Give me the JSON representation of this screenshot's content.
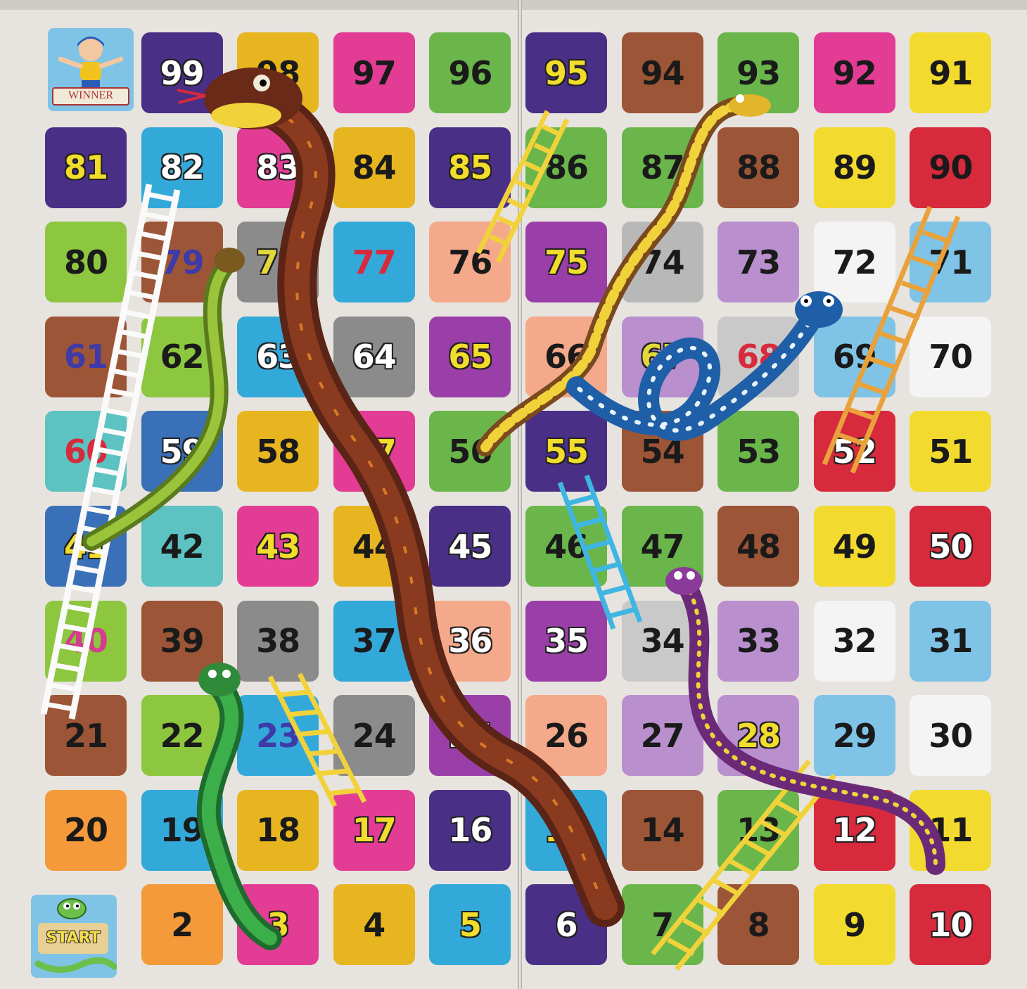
{
  "board": {
    "rows": [
      {
        "cells": [
          {
            "n": null,
            "bg": "#7fc3e6",
            "fg": "#000000"
          },
          {
            "n": "99",
            "bg": "#4a2f86",
            "fg": "#ffffff"
          },
          {
            "n": "98",
            "bg": "#e7b51f",
            "fg": "#1a1a1a"
          },
          {
            "n": "97",
            "bg": "#e33c95",
            "fg": "#1a1a1a"
          },
          {
            "n": "96",
            "bg": "#6ab64a",
            "fg": "#1a1a1a"
          },
          {
            "n": "95",
            "bg": "#4a2f86",
            "fg": "#f2dc2c"
          },
          {
            "n": "94",
            "bg": "#9c5536",
            "fg": "#1a1a1a"
          },
          {
            "n": "93",
            "bg": "#6ab64a",
            "fg": "#1a1a1a"
          },
          {
            "n": "92",
            "bg": "#e33c95",
            "fg": "#1a1a1a"
          },
          {
            "n": "91",
            "bg": "#f3da2f",
            "fg": "#1a1a1a"
          }
        ]
      },
      {
        "cells": [
          {
            "n": "81",
            "bg": "#4a2f86",
            "fg": "#f2dc2c"
          },
          {
            "n": "82",
            "bg": "#33a9d9",
            "fg": "#ffffff"
          },
          {
            "n": "83",
            "bg": "#e33c95",
            "fg": "#ffffff"
          },
          {
            "n": "84",
            "bg": "#e7b51f",
            "fg": "#1a1a1a"
          },
          {
            "n": "85",
            "bg": "#4a2f86",
            "fg": "#f2dc2c"
          },
          {
            "n": "86",
            "bg": "#6ab64a",
            "fg": "#1a1a1a"
          },
          {
            "n": "87",
            "bg": "#6ab64a",
            "fg": "#1a1a1a"
          },
          {
            "n": "88",
            "bg": "#9c5536",
            "fg": "#1a1a1a"
          },
          {
            "n": "89",
            "bg": "#f3da2f",
            "fg": "#1a1a1a"
          },
          {
            "n": "90",
            "bg": "#d72a3c",
            "fg": "#1a1a1a"
          }
        ]
      },
      {
        "cells": [
          {
            "n": "80",
            "bg": "#8dc63f",
            "fg": "#1a1a1a"
          },
          {
            "n": "79",
            "bg": "#9c5536",
            "fg": "#3e3aa8"
          },
          {
            "n": "78",
            "bg": "#8b8b8b",
            "fg": "#e3d83a"
          },
          {
            "n": "77",
            "bg": "#33a9d9",
            "fg": "#d72a3c"
          },
          {
            "n": "76",
            "bg": "#f4a98a",
            "fg": "#1a1a1a"
          },
          {
            "n": "75",
            "bg": "#9a3fa8",
            "fg": "#f2dc2c"
          },
          {
            "n": "74",
            "bg": "#b8b8b8",
            "fg": "#1a1a1a"
          },
          {
            "n": "73",
            "bg": "#b98fce",
            "fg": "#1a1a1a"
          },
          {
            "n": "72",
            "bg": "#f4f4f4",
            "fg": "#1a1a1a"
          },
          {
            "n": "71",
            "bg": "#7fc3e6",
            "fg": "#1a1a1a"
          }
        ]
      },
      {
        "cells": [
          {
            "n": "61",
            "bg": "#9c5536",
            "fg": "#3e3aa8"
          },
          {
            "n": "62",
            "bg": "#8dc63f",
            "fg": "#1a1a1a"
          },
          {
            "n": "63",
            "bg": "#33a9d9",
            "fg": "#ffffff"
          },
          {
            "n": "64",
            "bg": "#8b8b8b",
            "fg": "#ffffff"
          },
          {
            "n": "65",
            "bg": "#9a3fa8",
            "fg": "#f2dc2c"
          },
          {
            "n": "66",
            "bg": "#f4a98a",
            "fg": "#1a1a1a"
          },
          {
            "n": "67",
            "bg": "#b98fce",
            "fg": "#e3d83a"
          },
          {
            "n": "68",
            "bg": "#c9c9c9",
            "fg": "#d72a3c"
          },
          {
            "n": "69",
            "bg": "#7fc3e6",
            "fg": "#1a1a1a"
          },
          {
            "n": "70",
            "bg": "#f4f4f4",
            "fg": "#1a1a1a"
          }
        ]
      },
      {
        "cells": [
          {
            "n": "60",
            "bg": "#5cc2c2",
            "fg": "#d72a3c"
          },
          {
            "n": "59",
            "bg": "#3a70b8",
            "fg": "#ffffff"
          },
          {
            "n": "58",
            "bg": "#e7b51f",
            "fg": "#1a1a1a"
          },
          {
            "n": "57",
            "bg": "#e33c95",
            "fg": "#f2dc2c"
          },
          {
            "n": "56",
            "bg": "#6ab64a",
            "fg": "#1a1a1a"
          },
          {
            "n": "55",
            "bg": "#4a2f86",
            "fg": "#f2dc2c"
          },
          {
            "n": "54",
            "bg": "#9c5536",
            "fg": "#1a1a1a"
          },
          {
            "n": "53",
            "bg": "#6ab64a",
            "fg": "#1a1a1a"
          },
          {
            "n": "52",
            "bg": "#d72a3c",
            "fg": "#ffffff"
          },
          {
            "n": "51",
            "bg": "#f3da2f",
            "fg": "#1a1a1a"
          }
        ]
      },
      {
        "cells": [
          {
            "n": "41",
            "bg": "#3a70b8",
            "fg": "#f2dc2c"
          },
          {
            "n": "42",
            "bg": "#5cc2c2",
            "fg": "#1a1a1a"
          },
          {
            "n": "43",
            "bg": "#e33c95",
            "fg": "#f2dc2c"
          },
          {
            "n": "44",
            "bg": "#e7b51f",
            "fg": "#1a1a1a"
          },
          {
            "n": "45",
            "bg": "#4a2f86",
            "fg": "#ffffff"
          },
          {
            "n": "46",
            "bg": "#6ab64a",
            "fg": "#1a1a1a"
          },
          {
            "n": "47",
            "bg": "#6ab64a",
            "fg": "#1a1a1a"
          },
          {
            "n": "48",
            "bg": "#9c5536",
            "fg": "#1a1a1a"
          },
          {
            "n": "49",
            "bg": "#f3da2f",
            "fg": "#1a1a1a"
          },
          {
            "n": "50",
            "bg": "#d72a3c",
            "fg": "#ffffff"
          }
        ]
      },
      {
        "cells": [
          {
            "n": "40",
            "bg": "#8dc63f",
            "fg": "#d23e8a"
          },
          {
            "n": "39",
            "bg": "#9c5536",
            "fg": "#1a1a1a"
          },
          {
            "n": "38",
            "bg": "#8b8b8b",
            "fg": "#1a1a1a"
          },
          {
            "n": "37",
            "bg": "#33a9d9",
            "fg": "#1a1a1a"
          },
          {
            "n": "36",
            "bg": "#f4a98a",
            "fg": "#ffffff"
          },
          {
            "n": "35",
            "bg": "#9a3fa8",
            "fg": "#ffffff"
          },
          {
            "n": "34",
            "bg": "#c9c9c9",
            "fg": "#1a1a1a"
          },
          {
            "n": "33",
            "bg": "#b98fce",
            "fg": "#1a1a1a"
          },
          {
            "n": "32",
            "bg": "#f4f4f4",
            "fg": "#1a1a1a"
          },
          {
            "n": "31",
            "bg": "#7fc3e6",
            "fg": "#1a1a1a"
          }
        ]
      },
      {
        "cells": [
          {
            "n": "21",
            "bg": "#9c5536",
            "fg": "#1a1a1a"
          },
          {
            "n": "22",
            "bg": "#8dc63f",
            "fg": "#1a1a1a"
          },
          {
            "n": "23",
            "bg": "#33a9d9",
            "fg": "#3e3aa8"
          },
          {
            "n": "24",
            "bg": "#8b8b8b",
            "fg": "#1a1a1a"
          },
          {
            "n": "25",
            "bg": "#9a3fa8",
            "fg": "#ffffff"
          },
          {
            "n": "26",
            "bg": "#f4a98a",
            "fg": "#1a1a1a"
          },
          {
            "n": "27",
            "bg": "#b98fce",
            "fg": "#1a1a1a"
          },
          {
            "n": "28",
            "bg": "#b98fce",
            "fg": "#f2dc2c"
          },
          {
            "n": "29",
            "bg": "#7fc3e6",
            "fg": "#1a1a1a"
          },
          {
            "n": "30",
            "bg": "#f4f4f4",
            "fg": "#1a1a1a"
          }
        ]
      },
      {
        "cells": [
          {
            "n": "20",
            "bg": "#f49a3a",
            "fg": "#1a1a1a"
          },
          {
            "n": "19",
            "bg": "#33a9d9",
            "fg": "#1a1a1a"
          },
          {
            "n": "18",
            "bg": "#e7b51f",
            "fg": "#1a1a1a"
          },
          {
            "n": "17",
            "bg": "#e33c95",
            "fg": "#f2dc2c"
          },
          {
            "n": "16",
            "bg": "#4a2f86",
            "fg": "#ffffff"
          },
          {
            "n": "15",
            "bg": "#33a9d9",
            "fg": "#f2dc2c"
          },
          {
            "n": "14",
            "bg": "#9c5536",
            "fg": "#1a1a1a"
          },
          {
            "n": "13",
            "bg": "#6ab64a",
            "fg": "#1a1a1a"
          },
          {
            "n": "12",
            "bg": "#d72a3c",
            "fg": "#ffffff"
          },
          {
            "n": "11",
            "bg": "#f3da2f",
            "fg": "#1a1a1a"
          }
        ]
      },
      {
        "cells": [
          {
            "n": null,
            "bg": "#7fc3e6",
            "fg": "#000000"
          },
          {
            "n": "2",
            "bg": "#f49a3a",
            "fg": "#1a1a1a"
          },
          {
            "n": "3",
            "bg": "#e33c95",
            "fg": "#f2dc2c"
          },
          {
            "n": "4",
            "bg": "#e7b51f",
            "fg": "#1a1a1a"
          },
          {
            "n": "5",
            "bg": "#33a9d9",
            "fg": "#f2dc2c"
          },
          {
            "n": "6",
            "bg": "#4a2f86",
            "fg": "#ffffff"
          },
          {
            "n": "7",
            "bg": "#6ab64a",
            "fg": "#1a1a1a"
          },
          {
            "n": "8",
            "bg": "#9c5536",
            "fg": "#1a1a1a"
          },
          {
            "n": "9",
            "bg": "#f3da2f",
            "fg": "#1a1a1a"
          },
          {
            "n": "10",
            "bg": "#d72a3c",
            "fg": "#ffffff"
          }
        ]
      }
    ]
  },
  "winner_label": "WINNER",
  "start_label": "START",
  "icons": {
    "winner": "boy-mascot-icon",
    "start": "snake-mascot-icon"
  }
}
